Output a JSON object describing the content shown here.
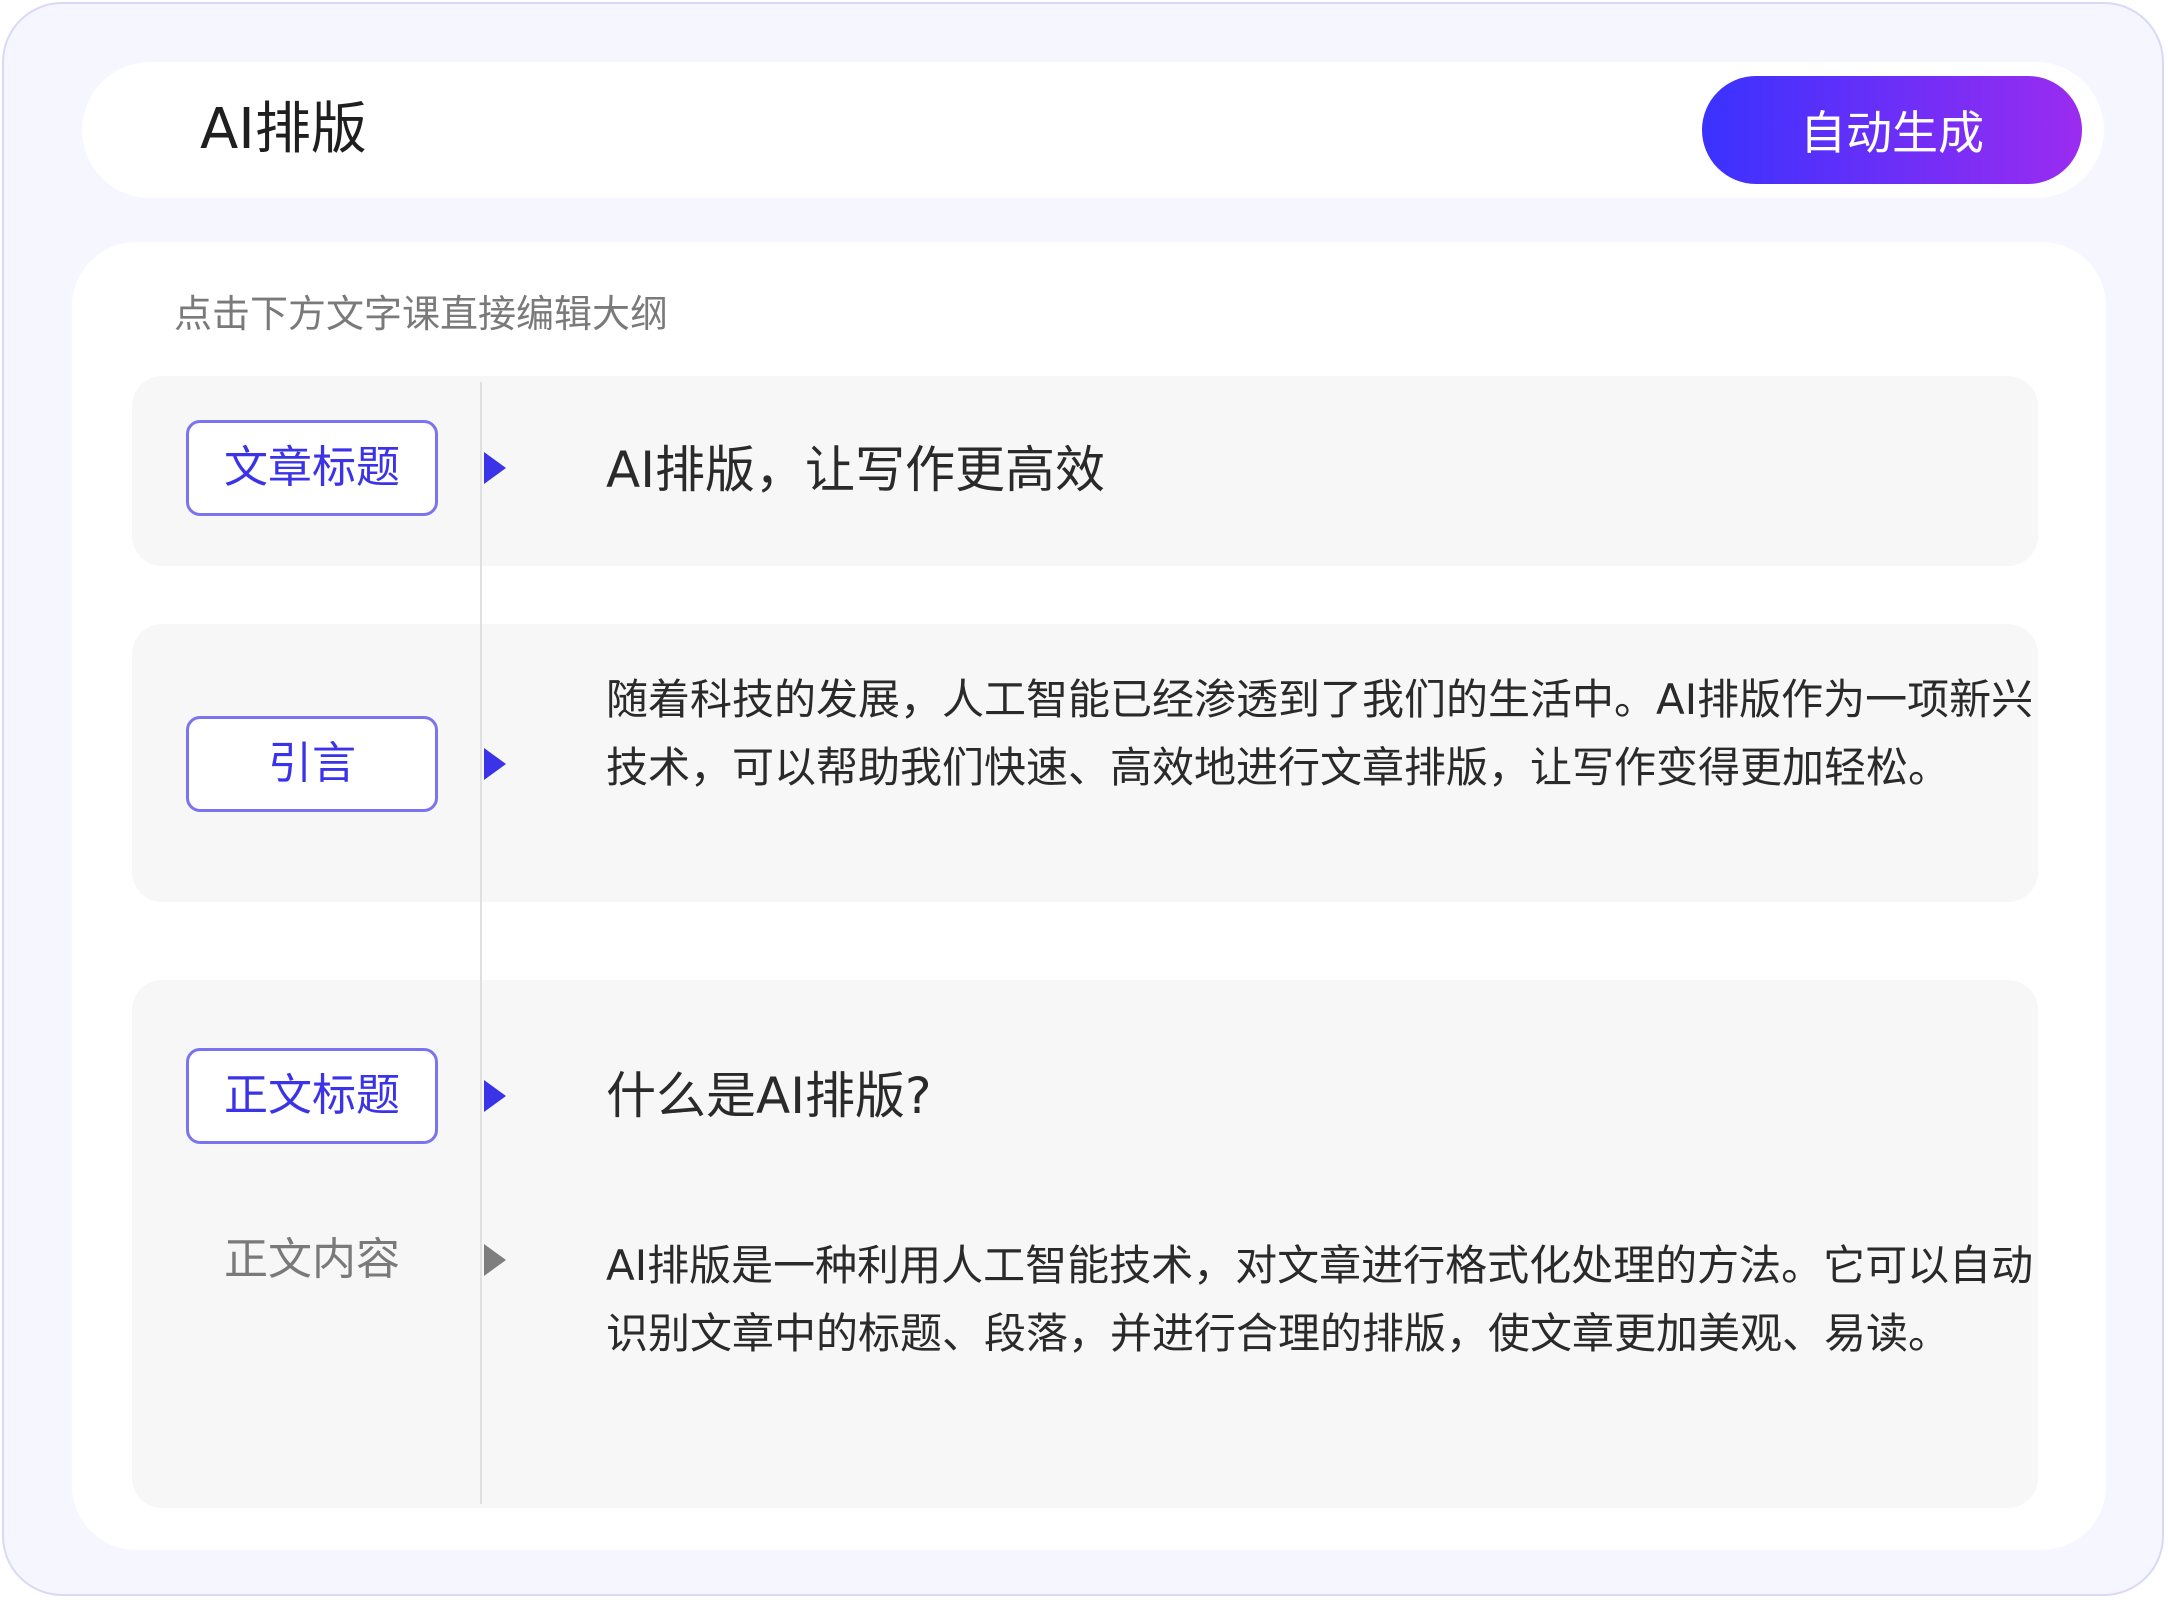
{
  "header": {
    "title": "AI排版",
    "auto_button_label": "自动生成"
  },
  "main": {
    "hint": "点击下方文字课直接编辑大纲",
    "sections": [
      {
        "tag": "文章标题",
        "content": "AI排版，让写作更高效"
      },
      {
        "tag": "引言",
        "content": "随着科技的发展，人工智能已经渗透到了我们的生活中。AI排版作为一项新兴技术，可以帮助我们快速、高效地进行文章排版，让写作变得更加轻松。"
      },
      {
        "tag": "正文标题",
        "content": "什么是AI排版?",
        "sub_tag": "正文内容",
        "sub_content": "AI排版是一种利用人工智能技术，对文章进行格式化处理的方法。它可以自动识别文章中的标题、段落，并进行合理的排版，使文章更加美观、易读。"
      }
    ]
  },
  "colors": {
    "accent": "#3b33e8",
    "gradient_start": "#3a32ff",
    "gradient_end": "#9b2cf0",
    "frame_bg": "#f5f6ff",
    "section_bg": "#f7f7f7"
  }
}
